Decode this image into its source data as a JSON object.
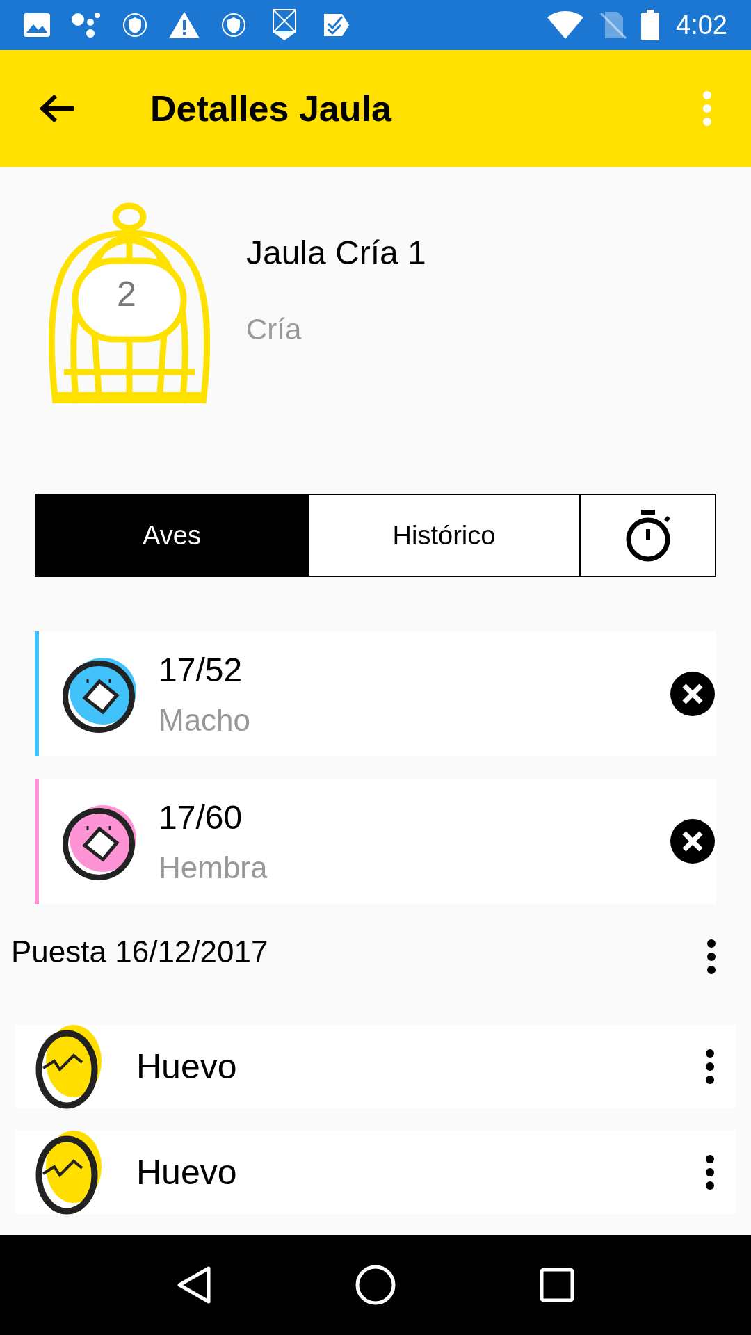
{
  "status_bar": {
    "time": "4:02"
  },
  "app_bar": {
    "title": "Detalles Jaula"
  },
  "cage": {
    "number": "2",
    "name": "Jaula Cría 1",
    "type": "Cría"
  },
  "tabs": [
    {
      "kind": "text",
      "label": "Aves",
      "selected": true
    },
    {
      "kind": "text",
      "label": "Histórico",
      "selected": false
    },
    {
      "kind": "timer",
      "selected": false
    }
  ],
  "birds": [
    {
      "ring": "17/52",
      "sex": "Macho",
      "color": "#42c2fb"
    },
    {
      "ring": "17/60",
      "sex": "Hembra",
      "color": "#fe94d6"
    }
  ],
  "clutch": {
    "title": "Puesta 16/12/2017"
  },
  "eggs": [
    {
      "label": "Huevo"
    },
    {
      "label": "Huevo"
    }
  ]
}
